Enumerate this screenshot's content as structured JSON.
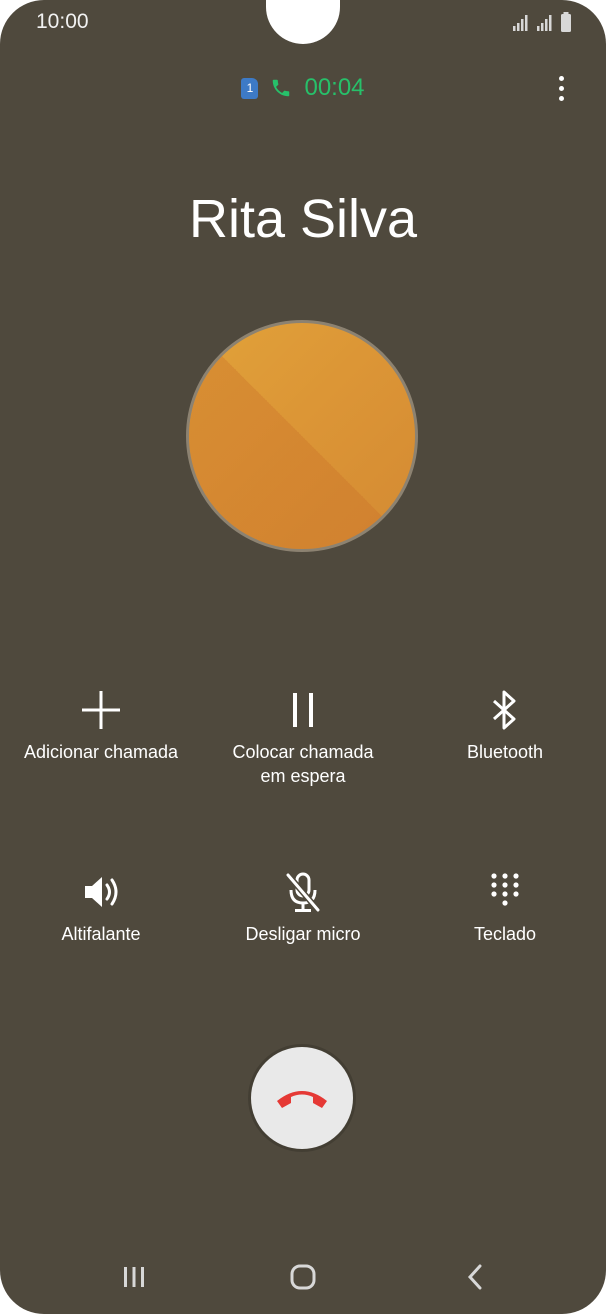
{
  "status_bar": {
    "time": "10:00",
    "signal_icon": "signal-icon",
    "battery_icon": "battery-icon"
  },
  "call": {
    "sim_label": "1",
    "timer": "00:04",
    "contact_name": "Rita Silva"
  },
  "controls": [
    {
      "label": "Adicionar chamada",
      "icon": "plus-icon"
    },
    {
      "label": "Colocar chamada em espera",
      "icon": "pause-icon"
    },
    {
      "label": "Bluetooth",
      "icon": "bluetooth-icon"
    },
    {
      "label": "Altifalante",
      "icon": "speaker-icon"
    },
    {
      "label": "Desligar micro",
      "icon": "mic-off-icon"
    },
    {
      "label": "Teclado",
      "icon": "keypad-icon"
    }
  ],
  "colors": {
    "background": "#4f493d",
    "timer": "#27c06a",
    "end_call_icon": "#e53935",
    "avatar": "#dc9636"
  }
}
